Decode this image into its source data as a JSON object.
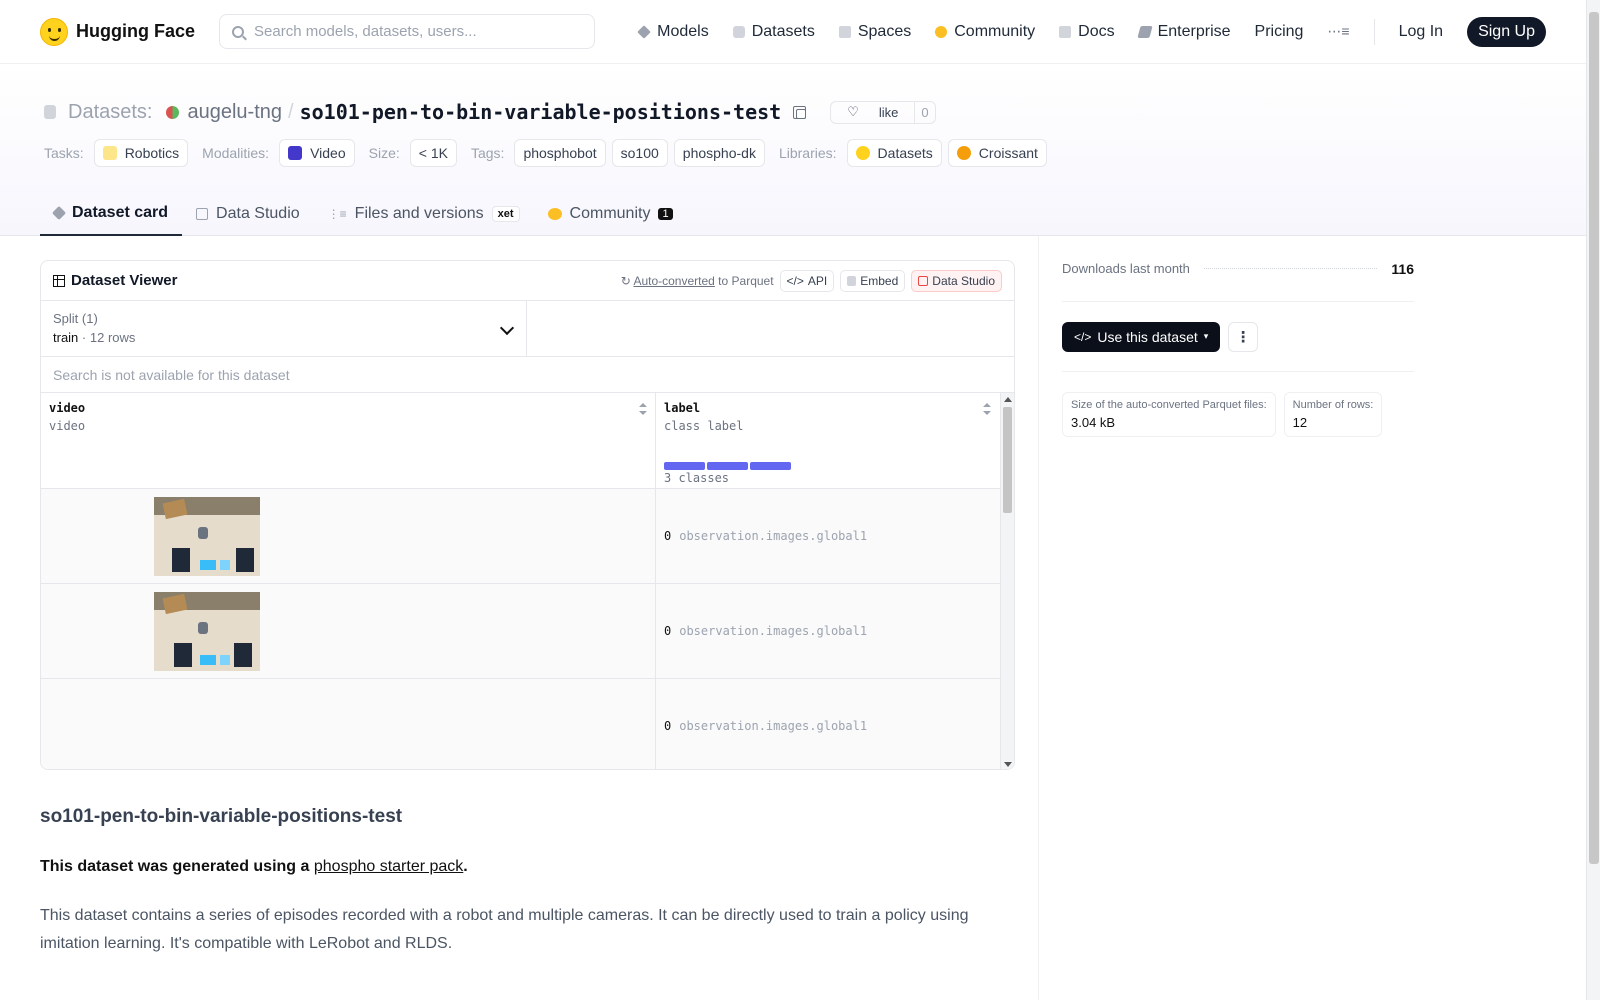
{
  "nav": {
    "logo_text": "Hugging Face",
    "search_placeholder": "Search models, datasets, users...",
    "links": [
      {
        "label": "Models",
        "icon": "models-icon",
        "color": "#9ca3af"
      },
      {
        "label": "Datasets",
        "icon": "datasets-icon",
        "color": "#9ca3af"
      },
      {
        "label": "Spaces",
        "icon": "spaces-icon",
        "color": "#9ca3af"
      },
      {
        "label": "Community",
        "icon": "community-icon",
        "color": "#fbbf24"
      },
      {
        "label": "Docs",
        "icon": "docs-icon",
        "color": "#9ca3af"
      },
      {
        "label": "Enterprise",
        "icon": "enterprise-icon",
        "color": "#9ca3af"
      }
    ],
    "pricing": "Pricing",
    "login": "Log In",
    "signup": "Sign Up"
  },
  "header": {
    "prefix": "Datasets:",
    "user": "augelu-tng",
    "separator": "/",
    "repo": "so101-pen-to-bin-variable-positions-test",
    "like_label": "like",
    "like_count": "0",
    "tasks_label": "Tasks:",
    "task": "Robotics",
    "modalities_label": "Modalities:",
    "modality": "Video",
    "size_label": "Size:",
    "size": "< 1K",
    "tags_label": "Tags:",
    "tags": [
      "phosphobot",
      "so100",
      "phospho-dk"
    ],
    "libraries_label": "Libraries:",
    "libraries": [
      "Datasets",
      "Croissant"
    ]
  },
  "tabs": {
    "dataset_card": "Dataset card",
    "data_studio": "Data Studio",
    "files": "Files and versions",
    "xet": "xet",
    "community": "Community",
    "community_count": "1"
  },
  "viewer": {
    "title": "Dataset Viewer",
    "auto_converted": "Auto-converted",
    "to_parquet": "to Parquet",
    "api": "API",
    "embed": "Embed",
    "data_studio": "Data Studio",
    "split_label": "Split (1)",
    "split_value": "train",
    "split_dot": "·",
    "split_rows": "12 rows",
    "search_na": "Search is not available for this dataset",
    "columns": [
      {
        "name": "video",
        "type": "video"
      },
      {
        "name": "label",
        "type": "class label",
        "classes": "3 classes"
      }
    ],
    "rows": [
      {
        "index": "0",
        "class": "observation.images.global1"
      },
      {
        "index": "0",
        "class": "observation.images.global1"
      },
      {
        "index": "0",
        "class": "observation.images.global1"
      }
    ]
  },
  "readme": {
    "heading": "so101-pen-to-bin-variable-positions-test",
    "generated_prefix": "This dataset was generated using a",
    "generated_link": "phospho starter pack",
    "generated_suffix": ".",
    "description": "This dataset contains a series of episodes recorded with a robot and multiple cameras. It can be directly used to train a policy using imitation learning. It's compatible with LeRobot and RLDS."
  },
  "sidebar": {
    "downloads_label": "Downloads last month",
    "downloads_value": "116",
    "use_button": "Use this dataset",
    "parquet_size_label": "Size of the auto-converted Parquet files:",
    "parquet_size_value": "3.04 kB",
    "rows_label": "Number of rows:",
    "rows_value": "12"
  },
  "colors": {
    "accent_dark": "#111827",
    "class_bar": "#6366f1",
    "header_bg": "#f7f6fd"
  }
}
